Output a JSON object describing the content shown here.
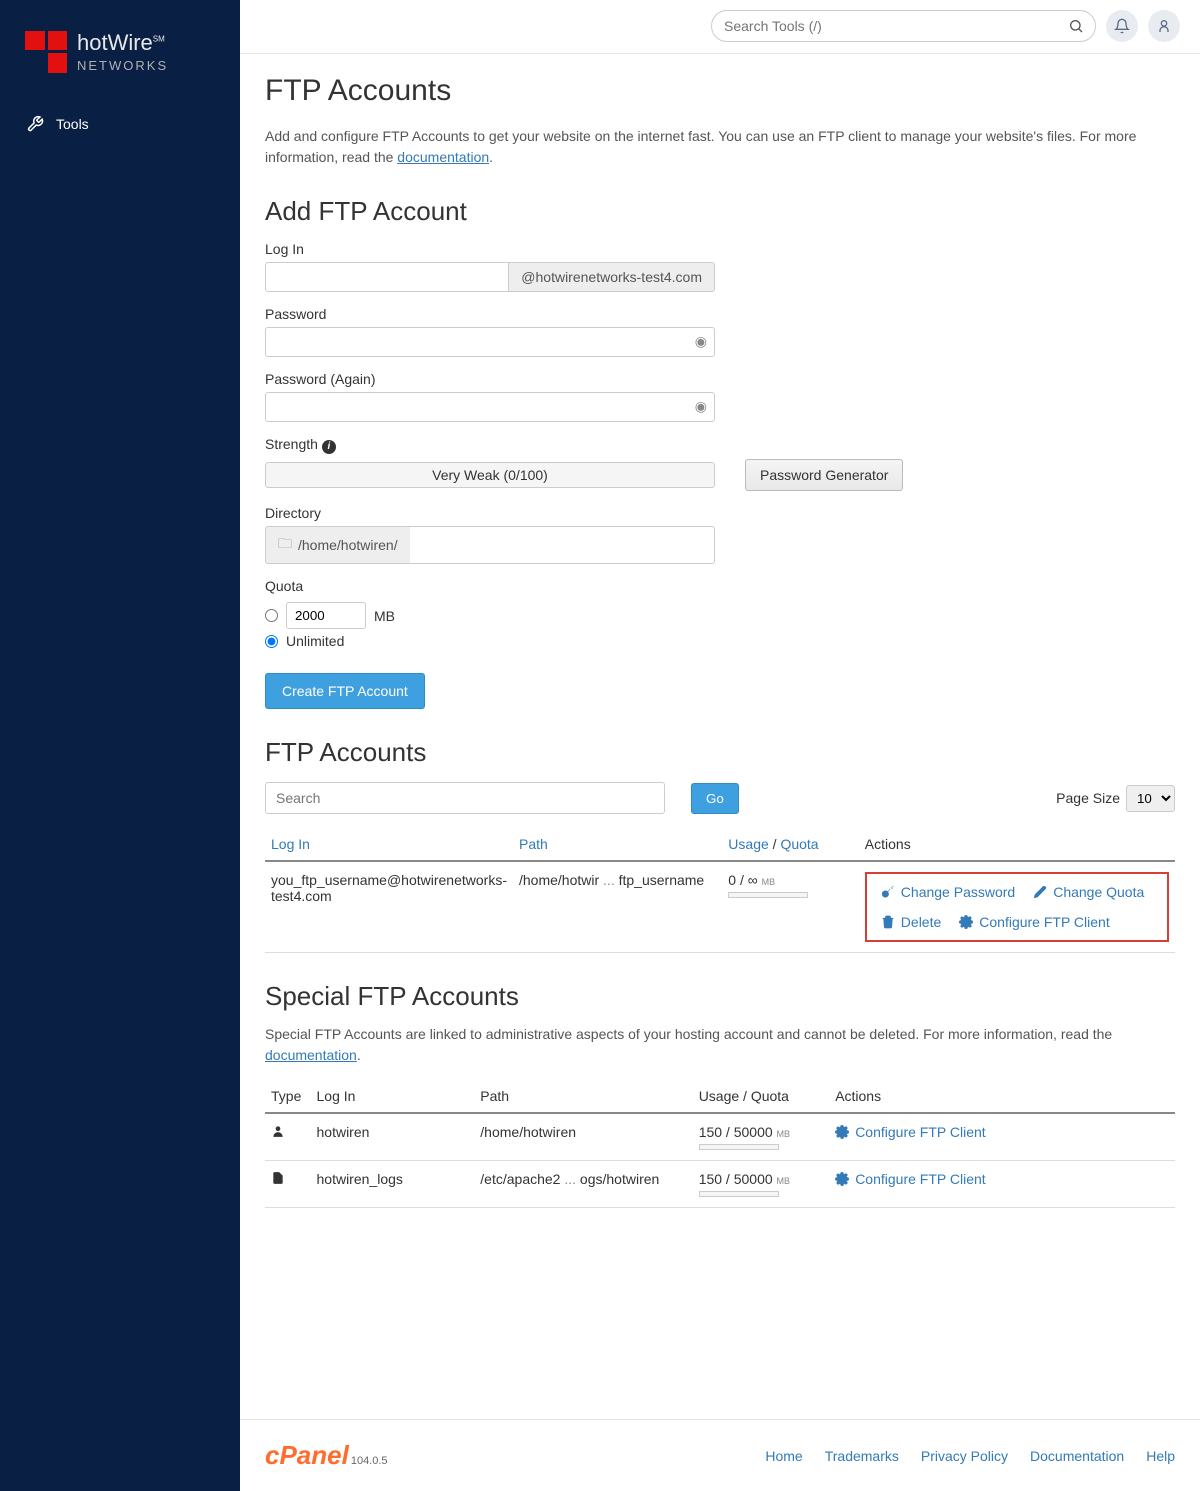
{
  "brand": {
    "name": "hotWire",
    "sub": "NETWORKS",
    "sm": "SM"
  },
  "nav": {
    "tools": "Tools"
  },
  "topbar": {
    "search_placeholder": "Search Tools (/)"
  },
  "title": "FTP Accounts",
  "intro": {
    "text1": "Add and configure FTP Accounts to get your website on the internet fast. You can use an FTP client to manage your website's files. For more information, read the ",
    "doc_link": "documentation",
    "text2": "."
  },
  "add": {
    "heading": "Add FTP Account",
    "login_label": "Log In",
    "login_suffix": "@hotwirenetworks-test4.com",
    "password_label": "Password",
    "password_again_label": "Password (Again)",
    "strength_label": "Strength",
    "strength_value": "Very Weak (0/100)",
    "generator_btn": "Password Generator",
    "directory_label": "Directory",
    "directory_prefix": "/home/hotwiren/",
    "quota_label": "Quota",
    "quota_value": "2000",
    "quota_unit": "MB",
    "quota_unlimited": "Unlimited",
    "create_btn": "Create FTP Account"
  },
  "accounts": {
    "heading": "FTP Accounts",
    "search_placeholder": "Search",
    "go_btn": "Go",
    "page_size_label": "Page Size",
    "page_size_value": "10",
    "cols": {
      "login": "Log In",
      "path": "Path",
      "usage": "Usage",
      "quota": "Quota",
      "sep": " / ",
      "actions": "Actions"
    },
    "rows": [
      {
        "login": "you_ftp_username@hotwirenetworks-test4.com",
        "path_a": "/home/hotwir",
        "path_b": "ftp_username",
        "usage": "0 / ∞",
        "unit": "MB"
      }
    ],
    "action_labels": {
      "change_password": "Change Password",
      "change_quota": "Change Quota",
      "delete": "Delete",
      "configure": "Configure FTP Client"
    }
  },
  "special": {
    "heading": "Special FTP Accounts",
    "text1": "Special FTP Accounts are linked to administrative aspects of your hosting account and cannot be deleted. For more information, read the ",
    "doc_link": "documentation",
    "text2": ".",
    "cols": {
      "type": "Type",
      "login": "Log In",
      "path": "Path",
      "usage": "Usage / Quota",
      "actions": "Actions"
    },
    "rows": [
      {
        "login": "hotwiren",
        "path_a": "/home/hotwiren",
        "path_b": "",
        "usage": "150 / 50000",
        "unit": "MB"
      },
      {
        "login": "hotwiren_logs",
        "path_a": "/etc/apache2",
        "path_b": "ogs/hotwiren",
        "usage": "150 / 50000",
        "unit": "MB"
      }
    ],
    "configure": "Configure FTP Client"
  },
  "footer": {
    "cpanel": "cPanel",
    "version": "104.0.5",
    "links": [
      "Home",
      "Trademarks",
      "Privacy Policy",
      "Documentation",
      "Help"
    ]
  }
}
